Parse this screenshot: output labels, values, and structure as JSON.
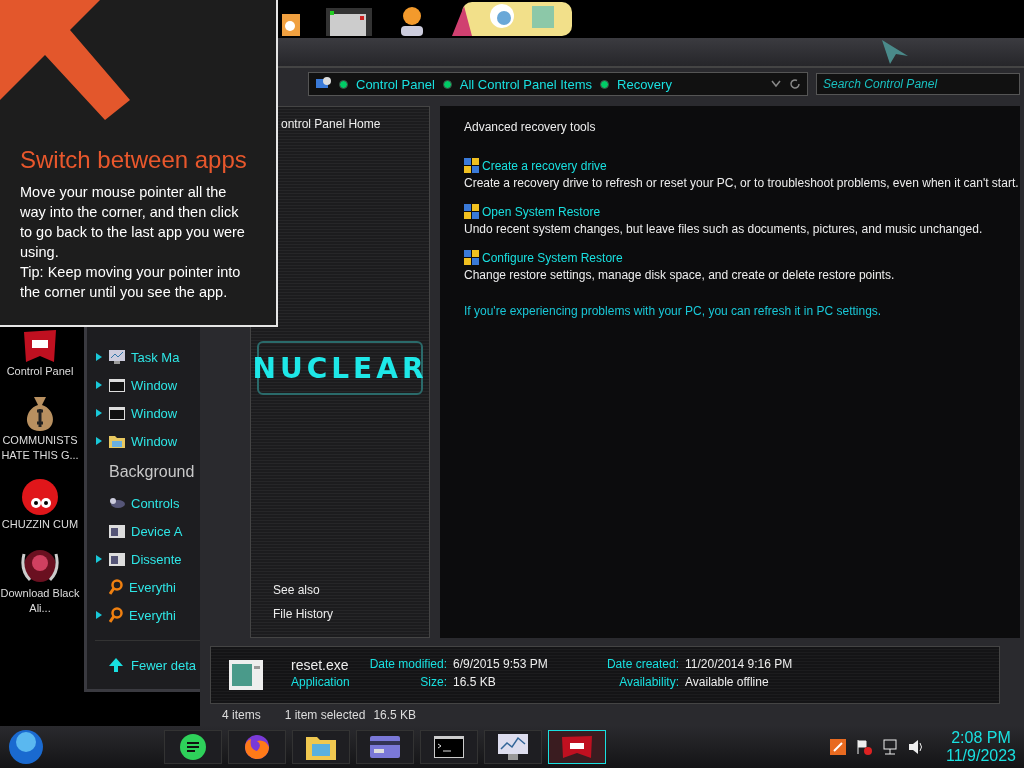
{
  "top_icons": [
    {
      "kind": "orange"
    },
    {
      "kind": "window"
    },
    {
      "kind": "person"
    },
    {
      "kind": "cartoon"
    }
  ],
  "desktop_icons": [
    {
      "label": "Control Panel",
      "kind": "panel"
    },
    {
      "label": "COMMUNISTS HATE THIS G...",
      "kind": "money"
    },
    {
      "label": "CHUZZIN CUM",
      "kind": "creature"
    },
    {
      "label": "Download Black Ali...",
      "kind": "orb"
    }
  ],
  "background_window": {
    "items": [
      {
        "label": "Task Ma",
        "kind": "item",
        "expandable": true
      },
      {
        "label": "Window",
        "kind": "item",
        "expandable": true
      },
      {
        "label": "Window",
        "kind": "item",
        "expandable": true
      },
      {
        "label": "Window",
        "kind": "item",
        "expandable": true
      },
      {
        "label": "Background",
        "kind": "header"
      },
      {
        "label": "Controls",
        "kind": "item",
        "expandable": false
      },
      {
        "label": "Device A",
        "kind": "item",
        "expandable": false
      },
      {
        "label": "Dissente",
        "kind": "item",
        "expandable": true
      },
      {
        "label": "Everythi",
        "kind": "item",
        "expandable": false
      },
      {
        "label": "Everythi",
        "kind": "item",
        "expandable": true
      }
    ],
    "footer": "Fewer deta"
  },
  "explorer": {
    "breadcrumbs": [
      "Control Panel",
      "All Control Panel Items",
      "Recovery"
    ],
    "search": {
      "placeholder": "Search Control Panel"
    },
    "sidebar": {
      "home_link": "ontrol Panel Home",
      "logo": "NUCLEAR",
      "see_also": "See also",
      "links": [
        "File History"
      ]
    },
    "content": {
      "heading": "Advanced recovery tools",
      "tools": [
        {
          "title": "Create a recovery drive",
          "description": "Create a recovery drive to refresh or reset your PC, or to troubleshoot problems, even when it can't start."
        },
        {
          "title": "Open System Restore",
          "description": "Undo recent system changes, but leave files such as documents, pictures, and music unchanged."
        },
        {
          "title": "Configure System Restore",
          "description": "Change restore settings, manage disk space, and create or delete restore points."
        }
      ],
      "footer_link": "If you're experiencing problems with your PC, you can refresh it in PC settings."
    },
    "details": {
      "name": "reset.exe",
      "type": "Application",
      "fields": [
        {
          "label": "Date modified:",
          "value": "6/9/2015 9:53 PM"
        },
        {
          "label": "Size:",
          "value": "16.5 KB"
        },
        {
          "label": "Date created:",
          "value": "11/20/2014 9:16 PM"
        },
        {
          "label": "Availability:",
          "value": "Available offline"
        }
      ]
    },
    "status_bar": {
      "count": "4 items",
      "selection": "1 item selected",
      "size": "16.5 KB"
    }
  },
  "tip": {
    "title": "Switch between apps",
    "body": [
      "Move your mouse pointer all the way into the corner, and then click to go back to the last app you were using.",
      "Tip: Keep moving your pointer into the corner until you see the app."
    ]
  },
  "taskbar": {
    "apps": [
      {
        "kind": "chat",
        "selected": false
      },
      {
        "kind": "browser",
        "selected": false
      },
      {
        "kind": "folder",
        "selected": false
      },
      {
        "kind": "card",
        "selected": false
      },
      {
        "kind": "console",
        "selected": false
      },
      {
        "kind": "monitor",
        "selected": false
      },
      {
        "kind": "panel",
        "selected": true
      }
    ],
    "clock": {
      "time": "2:08 PM",
      "date": "11/9/2023"
    }
  }
}
